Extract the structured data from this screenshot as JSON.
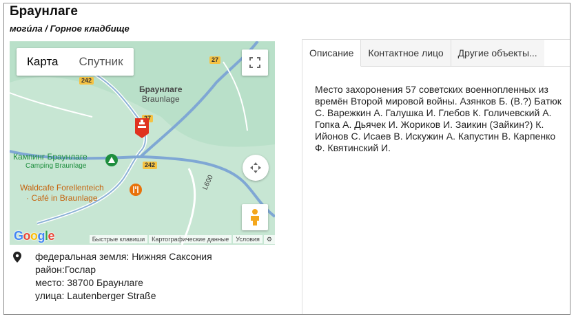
{
  "place": {
    "title": "Браунлаге",
    "subtitle": "могúла / Горное кладбище"
  },
  "map": {
    "type_map": "Карта",
    "type_satellite": "Спутник",
    "labels": {
      "town": "Браунлаге",
      "town_latin": "Braunlage",
      "camping": "Кампинг Браунлаге",
      "camping_latin": "Camping Braunlage",
      "cafe_line1": "Waldcafe Forellenteich",
      "cafe_line2": "· Café in Braunlage",
      "road_242a": "242",
      "road_242b": "242",
      "road_27a": "27",
      "road_27b": "27",
      "road_l600": "L600"
    },
    "logo": "Google",
    "attribution": {
      "shortcuts": "Быстрые клавиши",
      "mapdata": "Картографические данные",
      "terms": "Условия"
    },
    "colors": {
      "water": "#b8dec7",
      "roads": "#6b9fd4",
      "marker": "#e0321f"
    }
  },
  "address": {
    "land_label": "федеральная земля:",
    "land_value": "Нижняя Саксония",
    "district_label": "район:",
    "district_value": "Гослар",
    "place_label": "место:",
    "place_value": "38700 Браунлаге",
    "street_label": "улица:",
    "street_value": "Lautenberger Straße"
  },
  "tabs": {
    "description": "Описание",
    "contact": "Контактное лицо",
    "other": "Другие объекты..."
  },
  "description": "Место захоронения 57 советских военнопленных из времён Второй мировой войны. Азянков Б. (В.?) Батюк С. Варежкин А. Галушка И. Глебов К. Голичевский А. Гопка А. Дьячек И. Жориков И. Заикин (Зайкин?) К. Ийонов С. Исаев В. Искужин А. Капустин В. Карпенко Ф. Квятинский И."
}
